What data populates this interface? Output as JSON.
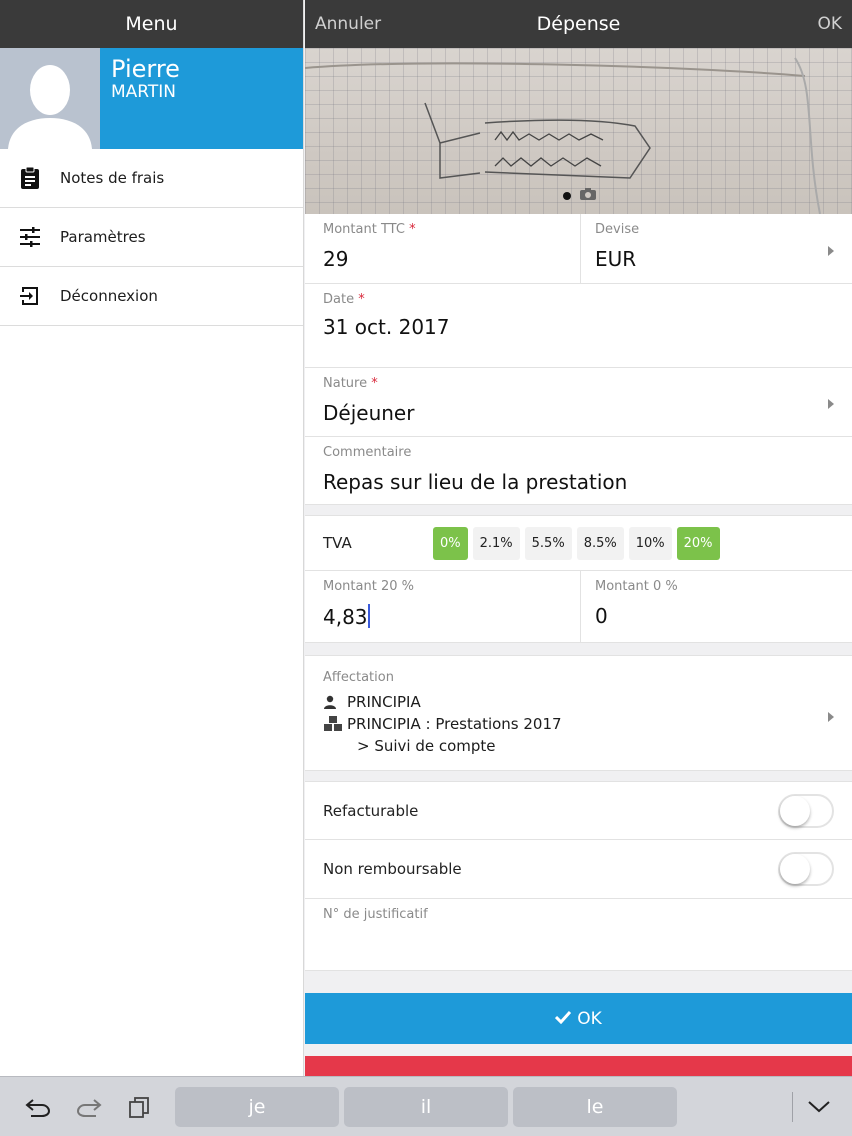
{
  "menu": {
    "title": "Menu",
    "profile": {
      "first_name": "Pierre",
      "last_name": "MARTIN"
    },
    "items": [
      {
        "label": "Notes de frais",
        "icon": "clipboard-icon"
      },
      {
        "label": "Paramètres",
        "icon": "sliders-icon"
      },
      {
        "label": "Déconnexion",
        "icon": "logout-icon"
      }
    ]
  },
  "nav": {
    "cancel_label": "Annuler",
    "title": "Dépense",
    "ok_label": "OK"
  },
  "form": {
    "amount": {
      "label": "Montant TTC",
      "required_mark": "*",
      "value": "29"
    },
    "currency": {
      "label": "Devise",
      "value": "EUR"
    },
    "date": {
      "label": "Date",
      "required_mark": "*",
      "value": "31 oct. 2017"
    },
    "nature": {
      "label": "Nature",
      "required_mark": "*",
      "value": "Déjeuner"
    },
    "comment": {
      "label": "Commentaire",
      "value": "Repas sur lieu de la prestation"
    },
    "tva": {
      "label": "TVA",
      "rates": [
        "0%",
        "2.1%",
        "5.5%",
        "8.5%",
        "10%",
        "20%"
      ],
      "selected": [
        "0%",
        "20%"
      ]
    },
    "amount20": {
      "label": "Montant 20 %",
      "value": "4,83"
    },
    "amount0": {
      "label": "Montant 0 %",
      "value": "0"
    },
    "affectation": {
      "label": "Affectation",
      "client": "PRINCIPIA",
      "project": "PRINCIPIA : Prestations 2017",
      "task": "> Suivi de compte"
    },
    "refacturable": {
      "label": "Refacturable",
      "on": false
    },
    "non_remboursable": {
      "label": "Non remboursable",
      "on": false
    },
    "justificatif": {
      "label": "N° de justificatif",
      "value": ""
    },
    "ok_button": "OK"
  },
  "keyboard": {
    "suggestions": [
      "je",
      "il",
      "le"
    ]
  },
  "colors": {
    "accent": "#1e9ad9",
    "header": "#3a3a3a",
    "green": "#7cc24a",
    "danger": "#e5384a",
    "required": "#d8273a"
  }
}
